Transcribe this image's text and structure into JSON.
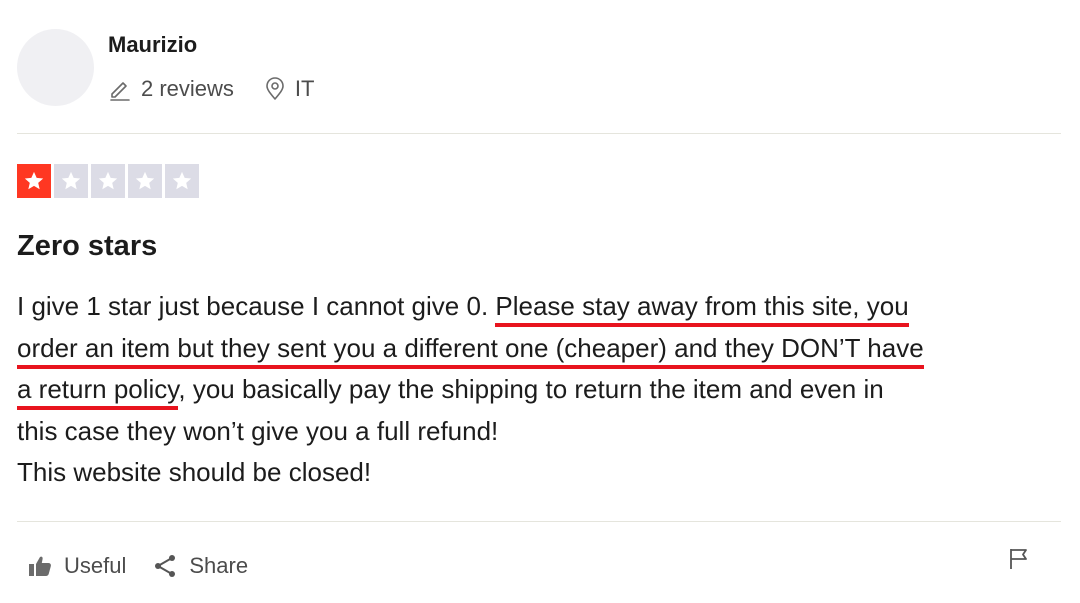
{
  "reviewer": {
    "name": "Maurizio",
    "reviews_count": "2 reviews",
    "location": "IT"
  },
  "rating": {
    "value": 1,
    "max": 5,
    "filled_color": "#ff3722",
    "empty_color": "#dcdce6"
  },
  "review": {
    "title": "Zero stars",
    "lines": [
      {
        "pre": "I give 1 star just because I cannot give 0. ",
        "hl": "Please stay away from this site, you",
        "post": ""
      },
      {
        "pre": "",
        "hl": "order an item but they sent you a different one (cheaper) and they DON’T have",
        "post": ""
      },
      {
        "pre": "",
        "hl": "a return policy",
        "post": ", you basically pay the shipping to return the item and even in"
      },
      {
        "pre": "this case they won’t give you a full refund!",
        "hl": "",
        "post": ""
      },
      {
        "pre": "This website should be closed!",
        "hl": "",
        "post": ""
      }
    ],
    "highlight_color": "#e8141e"
  },
  "actions": {
    "useful_label": "Useful",
    "share_label": "Share"
  },
  "icons": {
    "reviews": "pencil-icon",
    "location": "location-pin-icon",
    "useful": "thumbs-up-icon",
    "share": "share-icon",
    "report": "flag-icon",
    "star": "star-icon"
  }
}
